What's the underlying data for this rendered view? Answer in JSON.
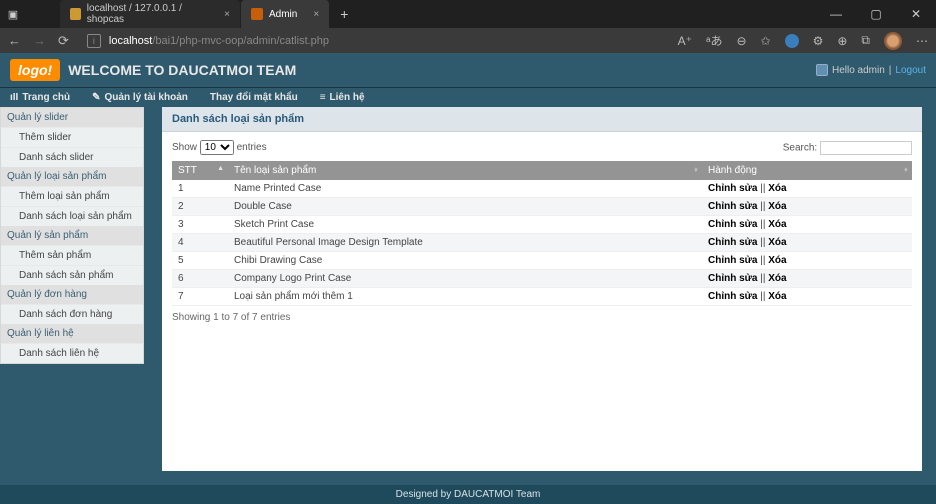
{
  "browser": {
    "tabs": [
      {
        "label": "localhost / 127.0.0.1 / shopcas"
      },
      {
        "label": "Admin"
      }
    ],
    "url_host": "localhost",
    "url_path": "/bai1/php-mvc-oop/admin/catlist.php"
  },
  "header": {
    "logo": "logo!",
    "welcome": "WELCOME TO DAUCATMOI TEAM",
    "hello": "Hello admin",
    "sep": " | ",
    "logout": "Logout"
  },
  "topnav": [
    "Trang chủ",
    "Quản lý tài khoản",
    "Thay đổi mật khẩu",
    "Liên hệ"
  ],
  "sidebar": [
    {
      "head": "Quản lý slider",
      "items": [
        "Thêm slider",
        "Danh sách slider"
      ]
    },
    {
      "head": "Quản lý loại sản phẩm",
      "items": [
        "Thêm loại sản phẩm",
        "Danh sách loại sản phẩm"
      ]
    },
    {
      "head": "Quản lý sản phẩm",
      "items": [
        "Thêm sản phẩm",
        "Danh sách sản phẩm"
      ]
    },
    {
      "head": "Quản lý đơn hàng",
      "items": [
        "Danh sách đơn hàng"
      ]
    },
    {
      "head": "Quản lý liên hệ",
      "items": [
        "Danh sách liên hệ"
      ]
    }
  ],
  "panel": {
    "title": "Danh sách loại sản phẩm",
    "show_label": "Show",
    "entries_label": "entries",
    "page_size": "10",
    "search_label": "Search:",
    "columns": [
      "STT",
      "Tên loại sản phẩm",
      "Hành động"
    ],
    "rows": [
      {
        "stt": "1",
        "name": "Name Printed Case"
      },
      {
        "stt": "2",
        "name": "Double Case"
      },
      {
        "stt": "3",
        "name": "Sketch Print Case"
      },
      {
        "stt": "4",
        "name": "Beautiful Personal Image Design Template"
      },
      {
        "stt": "5",
        "name": "Chibi Drawing Case"
      },
      {
        "stt": "6",
        "name": "Company Logo Print Case"
      },
      {
        "stt": "7",
        "name": "Loại sản phẩm mới thêm 1"
      }
    ],
    "action_edit": "Chỉnh sửa",
    "action_sep": " || ",
    "action_del": "Xóa",
    "info": "Showing 1 to 7 of 7 entries"
  },
  "footer": "Designed by DAUCATMOI Team"
}
